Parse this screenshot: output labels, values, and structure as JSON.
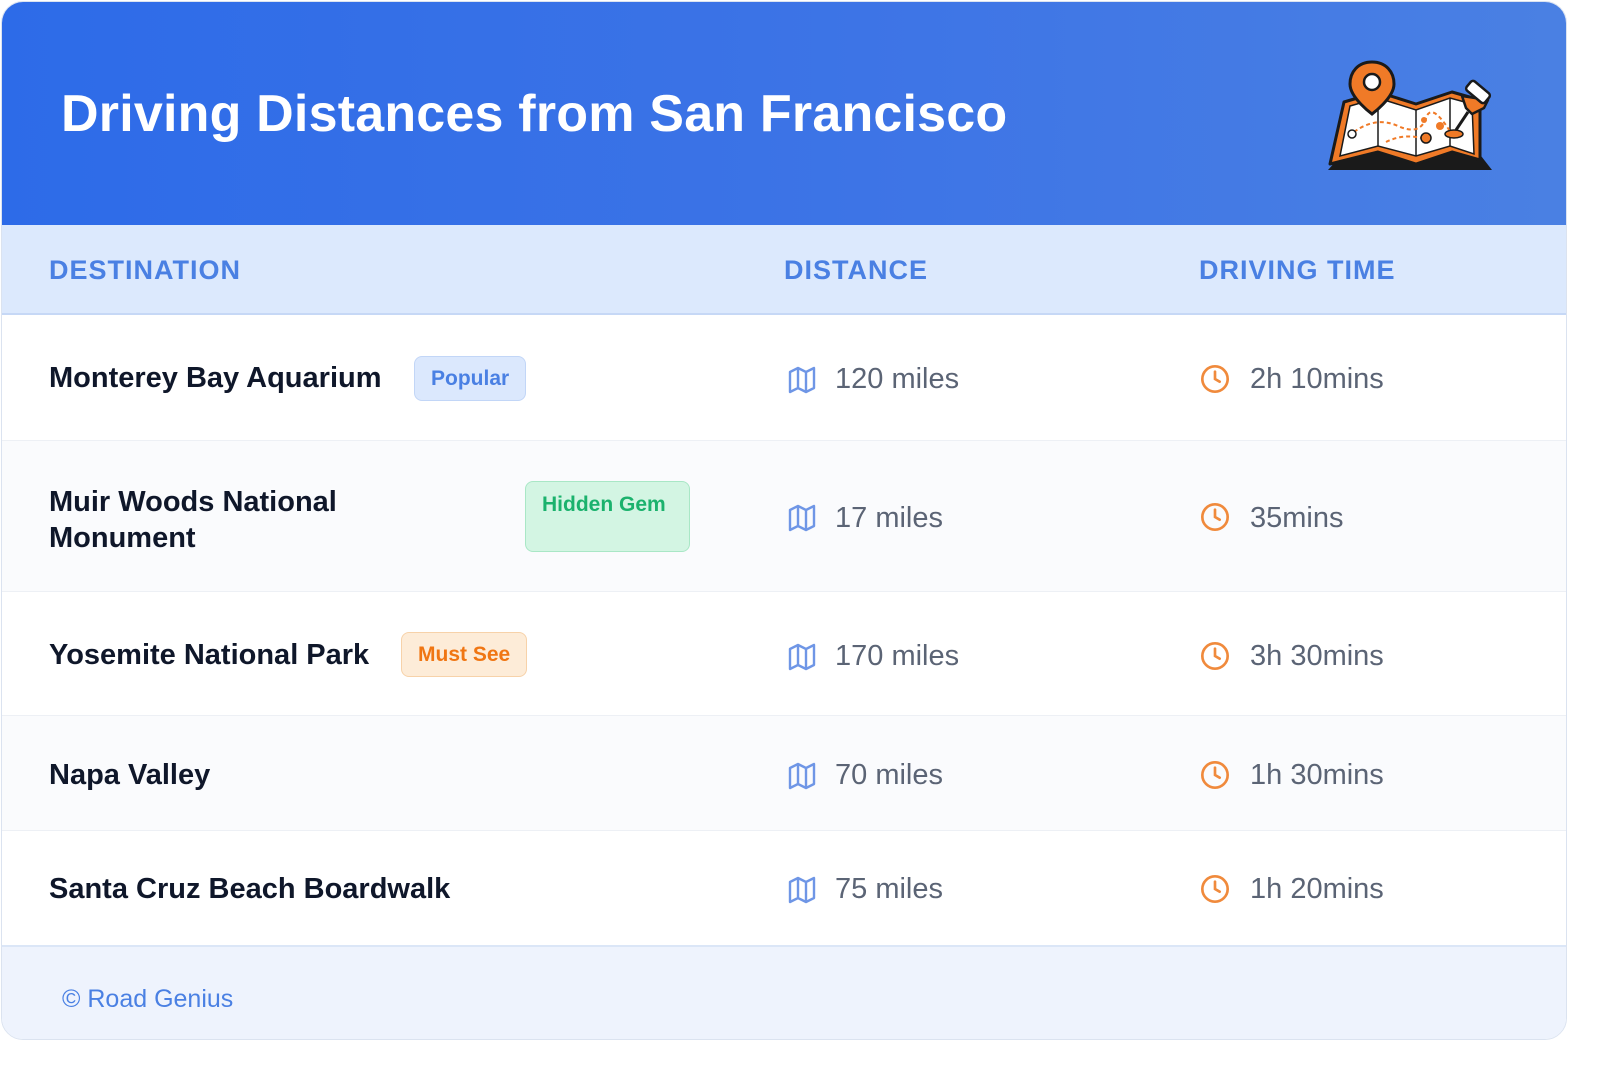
{
  "header": {
    "title": "Driving Distances from San Francisco",
    "illustration": "folded-map-with-location-pin-and-pushpin-icon"
  },
  "columns": {
    "destination": "DESTINATION",
    "distance": "DISTANCE",
    "driving_time": "DRIVING TIME"
  },
  "rows": [
    {
      "destination": "Monterey Bay Aquarium",
      "badge": "Popular",
      "distance": "120 miles",
      "time": "2h 10mins"
    },
    {
      "destination": "Muir Woods National Monument",
      "badge": "Hidden Gem",
      "distance": "17 miles",
      "time": "35mins"
    },
    {
      "destination": "Yosemite National Park",
      "badge": "Must See",
      "distance": "170 miles",
      "time": "3h 30mins"
    },
    {
      "destination": "Napa Valley",
      "badge": "",
      "distance": "70 miles",
      "time": "1h 30mins"
    },
    {
      "destination": "Santa Cruz Beach Boardwalk",
      "badge": "",
      "distance": "75 miles",
      "time": "1h 20mins"
    }
  ],
  "footer": {
    "copyright": "© Road Genius"
  },
  "icons": {
    "distance": "map-icon",
    "time": "clock-icon"
  },
  "colors": {
    "header_gradient_start": "#2d6be8",
    "header_gradient_end": "#4a80e3",
    "column_header_bg": "#dce9fd",
    "accent_blue": "#4a80e3",
    "accent_orange": "#f08a3c",
    "badge_popular_bg": "#dbe8fd",
    "badge_gem_bg": "#d3f5e3",
    "badge_gem_text": "#1bb26d",
    "badge_must_bg": "#fdecd8",
    "badge_must_text": "#f07613"
  }
}
